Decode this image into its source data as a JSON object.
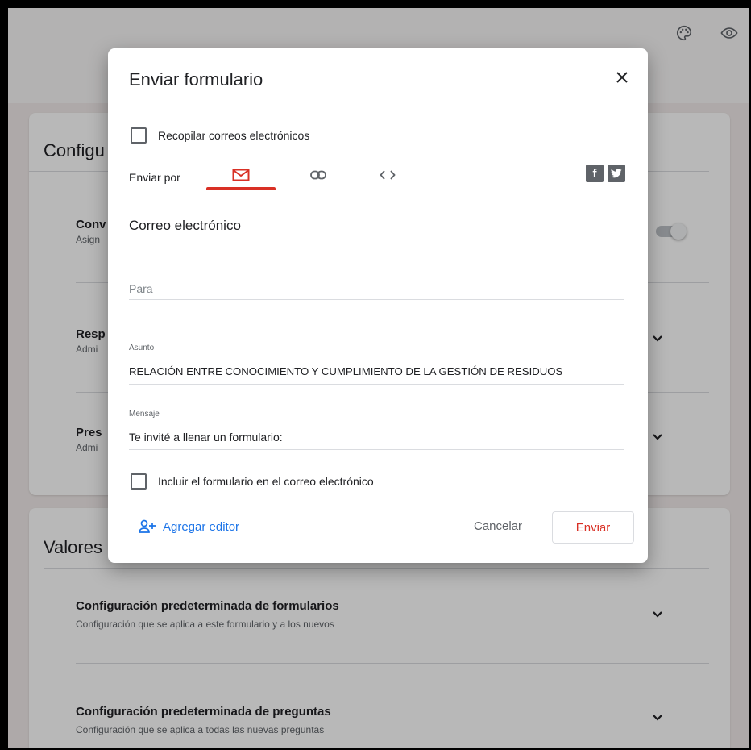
{
  "background": {
    "card1": {
      "title": "Configu",
      "rows": [
        {
          "title": "Conv",
          "sub": "Asign"
        },
        {
          "title": "Resp",
          "sub": "Admi"
        },
        {
          "title": "Pres",
          "sub": "Admi"
        }
      ]
    },
    "card2": {
      "title": "Valores p",
      "rows": [
        {
          "title": "Configuración predeterminada de formularios",
          "sub": "Configuración que se aplica a este formulario y a los nuevos"
        },
        {
          "title": "Configuración predeterminada de preguntas",
          "sub": "Configuración que se aplica a todas las nuevas preguntas"
        }
      ]
    }
  },
  "dialog": {
    "title": "Enviar formulario",
    "collect_emails_label": "Recopilar correos electrónicos",
    "send_via_label": "Enviar por",
    "section_title": "Correo electrónico",
    "to": {
      "placeholder": "Para"
    },
    "subject": {
      "label": "Asunto",
      "value": "RELACIÓN ENTRE CONOCIMIENTO Y CUMPLIMIENTO DE LA GESTIÓN DE RESIDUOS"
    },
    "message": {
      "label": "Mensaje",
      "value": "Te invité a llenar un formulario:"
    },
    "include_form_label": "Incluir el formulario en el correo electrónico",
    "add_editor_label": "Agregar editor",
    "cancel_label": "Cancelar",
    "send_label": "Enviar",
    "social": {
      "facebook": "f",
      "twitter": "t"
    }
  },
  "icons": {
    "palette": "palette-icon",
    "preview": "eye-icon",
    "email_tab": "mail-icon",
    "link_tab": "link-icon",
    "embed_tab": "code-icon",
    "close": "close-icon",
    "add_person": "person-add-icon"
  },
  "colors": {
    "accent": "#d93025",
    "link": "#1a73e8",
    "text": "#202124",
    "secondary": "#5f6368"
  }
}
